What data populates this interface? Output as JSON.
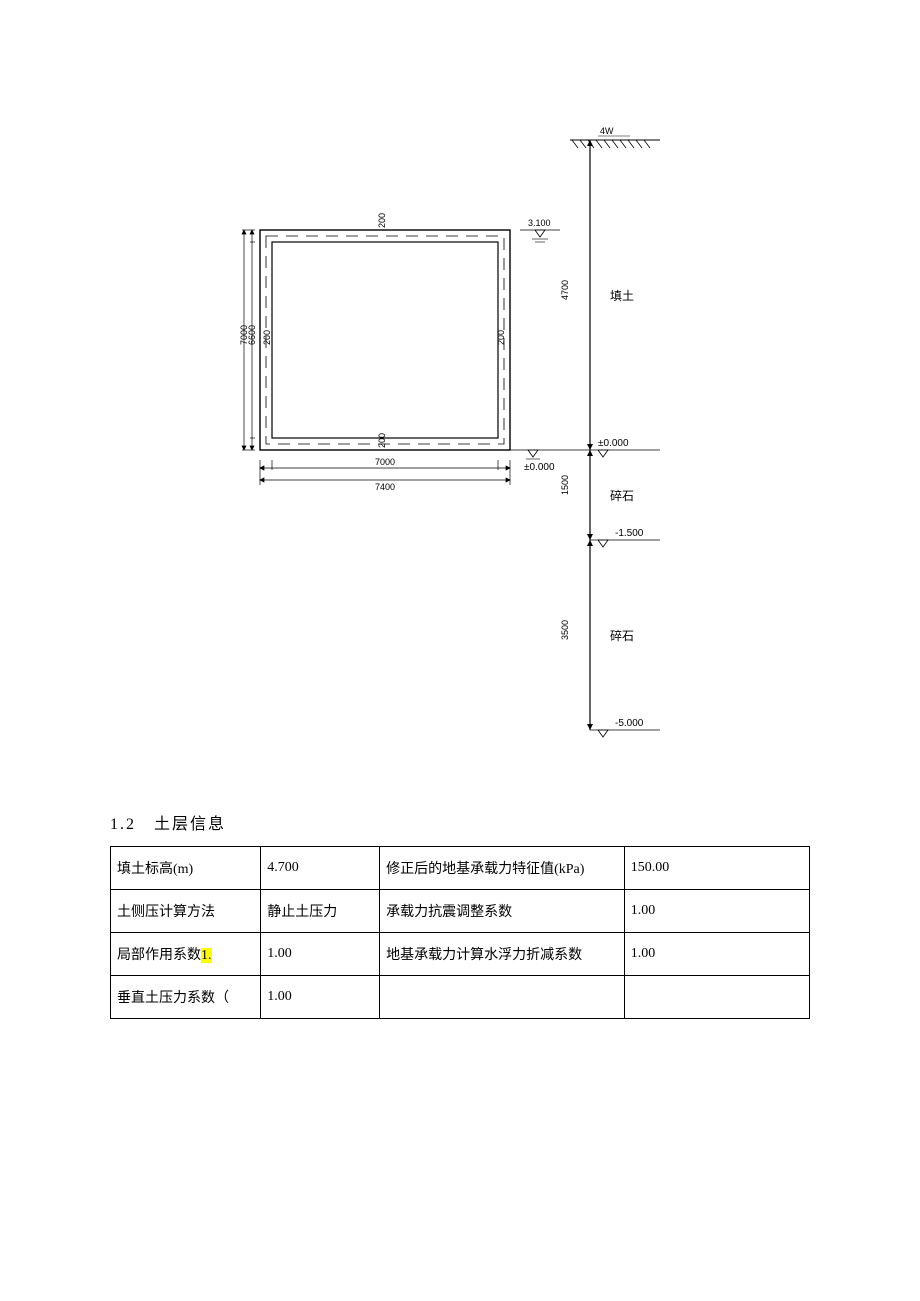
{
  "section": {
    "number": "1.2",
    "title": "土层信息"
  },
  "table": {
    "r1c1": "填土标高(m)",
    "r1c2": "4.700",
    "r1c3": "修正后的地基承载力特征值(kPa)",
    "r1c4": "150.00",
    "r2c1": "土侧压计算方法",
    "r2c2": "静止土压力",
    "r2c3": "承载力抗震调整系数",
    "r2c4": "1.00",
    "r3c1": "局部作用系数",
    "r3c1_hl": "1.",
    "r3c2": "1.00",
    "r3c3": "地基承载力计算水浮力折减系数",
    "r3c4": "1.00",
    "r4c1": "垂直土压力系数（",
    "r4c2": "1.00",
    "r4c3": "",
    "r4c4": ""
  },
  "dia": {
    "top_load": "4W",
    "water_top": "3.100",
    "soil_top": "填土",
    "fill_depth": "4700",
    "level0": "±0.000",
    "span1": "1500",
    "rock1": "碎石",
    "level1": "-1.500",
    "span2": "3500",
    "rock2": "碎石",
    "level2": "-5.000",
    "box_outer_w": "7400",
    "box_inner_w": "7000",
    "box_outer_h": "7000",
    "box_inner_h": "6600",
    "thk1": "200",
    "thk2": "200",
    "thk3": "200",
    "thk4": "200"
  }
}
